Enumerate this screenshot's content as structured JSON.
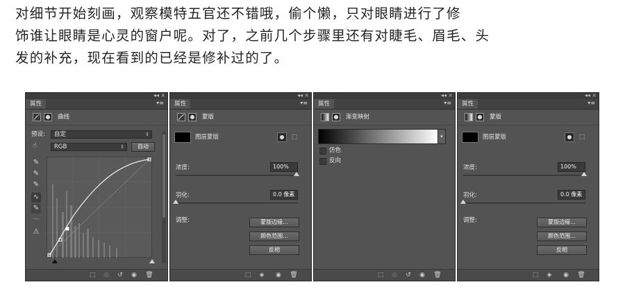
{
  "paragraph": {
    "line1": "对细节开始刻画，观察模特五官还不错哦，偷个懒，只对眼睛进行了修",
    "line2": "饰谁让眼睛是心灵的窗户呢。对了，之前几个步骤里还有对睫毛、眉毛、头",
    "line3": "发的补充，现在看到的已经是修补过的了。"
  },
  "panel_controls": {
    "collapse": "◂◂",
    "close": "×",
    "menu": "▾≡"
  },
  "curves_panel": {
    "tab": "属性",
    "header_title": "曲线",
    "preset_label": "预设:",
    "preset_value": "自定",
    "channel_value": "RGB",
    "auto_button": "自动",
    "icons": [
      "curves-icon",
      "mask-icon",
      "hand-adjust-icon",
      "eyedropper-black-icon",
      "eyedropper-gray-icon",
      "eyedropper-white-icon",
      "curve-tool-icon",
      "pencil-icon",
      "smooth-icon",
      "clipping-icon"
    ]
  },
  "mask_panel": {
    "tab": "属性",
    "header_title": "蒙版",
    "mask_label": "图层蒙版",
    "density_label": "浓度:",
    "density_value": "100%",
    "density": 1.0,
    "feather_label": "羽化:",
    "feather_value": "0.0 像素",
    "feather": 0.0,
    "adjust_label": "调整:",
    "btn_mask_edge": "蒙版边缘...",
    "btn_color_range": "颜色范围...",
    "btn_invert": "反相"
  },
  "gradient_panel": {
    "tab": "属性",
    "header_title": "渐变映射",
    "dither_label": "仿色",
    "reverse_label": "反向"
  },
  "mask_panel_2": {
    "tab": "属性",
    "header_title": "蒙版",
    "mask_label": "图层蒙版",
    "density_label": "浓度:",
    "density_value": "100%",
    "density": 1.0,
    "feather_label": "羽化:",
    "feather_value": "0.0 像素",
    "feather": 0.0,
    "adjust_label": "调整:",
    "btn_mask_edge": "蒙版边缘...",
    "btn_color_range": "颜色范围...",
    "btn_invert": "反相"
  },
  "colors": {
    "panel_bg": "#535353",
    "dark_bg": "#3a3a3a",
    "text": "#e0e0e0"
  }
}
